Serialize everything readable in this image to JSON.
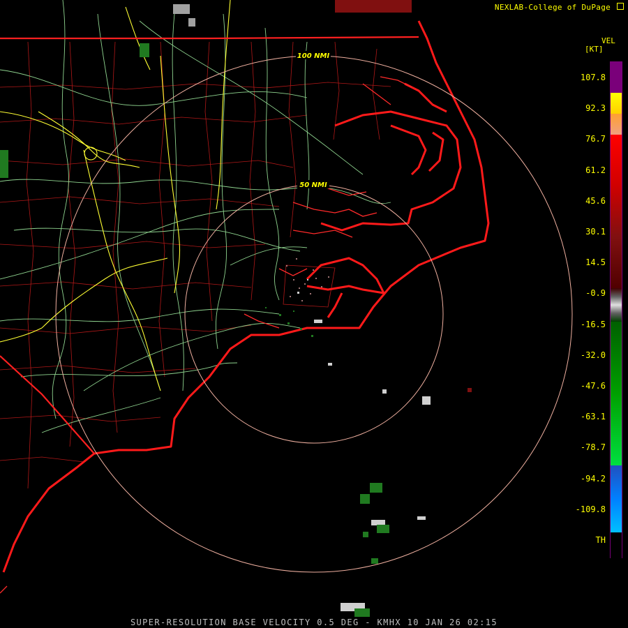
{
  "credit": "NEXLAB-College of DuPage",
  "credit_icon": "external-link-icon",
  "legend": {
    "product": "VEL",
    "unit": "[KT]",
    "ticks": [
      "107.8",
      "92.3",
      "76.7",
      "61.2",
      "45.6",
      "30.1",
      "14.5",
      "-0.9",
      "-16.5",
      "-32.0",
      "-47.6",
      "-63.1",
      "-78.7",
      "-94.2",
      "-109.8",
      "TH"
    ]
  },
  "range_rings": {
    "outer_label": "100 NMI",
    "inner_label": "50 NMI"
  },
  "footer": "SUPER-RESOLUTION BASE VELOCITY 0.5 DEG - KMHX 10 JAN 26 02:15",
  "colors": {
    "coast": "#ff2020",
    "counties": "#c01818",
    "roads": "#8fd48f",
    "interstates": "#ffff33",
    "rings": "#f0b0a0",
    "label": "#ffff00",
    "footer": "#c0c0c0"
  }
}
